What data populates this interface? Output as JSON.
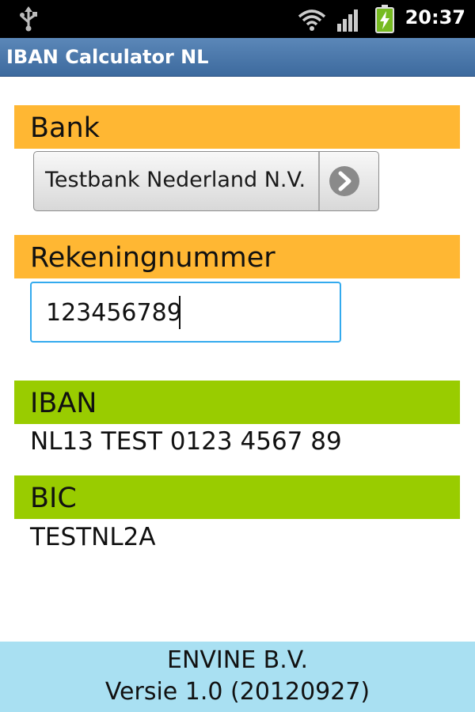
{
  "status_bar": {
    "time": "20:37",
    "icons": [
      "usb-icon",
      "wifi-icon",
      "signal-icon",
      "battery-charging-icon"
    ]
  },
  "app": {
    "title": "IBAN Calculator NL"
  },
  "bank": {
    "label": "Bank",
    "selected": "Testbank Nederland N.V."
  },
  "account": {
    "label": "Rekeningnummer",
    "value": "123456789"
  },
  "iban": {
    "label": "IBAN",
    "value": "NL13 TEST 0123 4567 89"
  },
  "bic": {
    "label": "BIC",
    "value": "TESTNL2A"
  },
  "footer": {
    "company": "ENVINE B.V.",
    "version": "Versie 1.0 (20120927)"
  },
  "colors": {
    "header_orange": "#ffb733",
    "header_green": "#99cc00",
    "footer_blue": "#a9e0f2",
    "titlebar_blue": "#4a77aa",
    "input_focus": "#33aaee"
  }
}
